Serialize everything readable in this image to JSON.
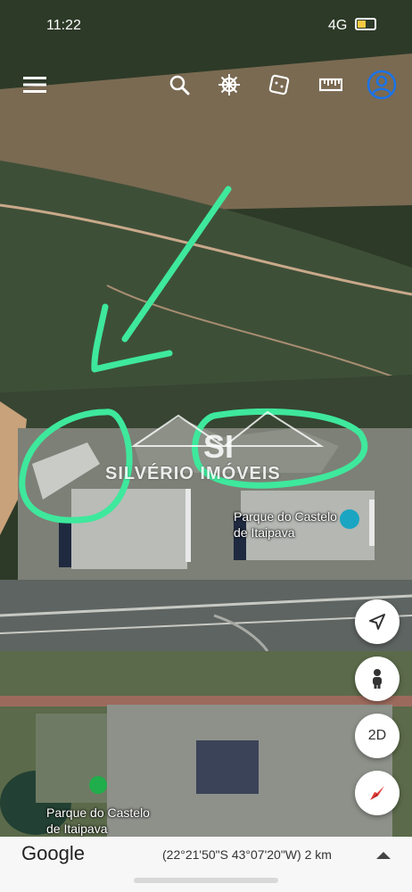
{
  "status_bar": {
    "time": "11:22",
    "network": "4G",
    "battery_level": 0.5
  },
  "toolbar": {
    "menu_icon": "hamburger-menu-icon",
    "search_icon": "search-icon",
    "voyager_icon": "ships-wheel-icon",
    "feeling_lucky_icon": "dice-icon",
    "measure_icon": "ruler-icon",
    "account_icon": "account-icon"
  },
  "map": {
    "place_label_1": {
      "line1": "Parque do Castelo",
      "line2": "de Itaipava"
    },
    "place_label_2": {
      "line1": "Parque do Castelo",
      "line2": "de Itaipava"
    },
    "watermark_letters": "SI",
    "watermark_text": "SILVÉRIO IMÓVEIS",
    "annotation_color": "#3ee89c"
  },
  "controls": {
    "view_mode": "2D"
  },
  "bottom_bar": {
    "brand": "Google",
    "coordinates": "(22°21'50\"S 43°07'20\"W) 2 km"
  }
}
